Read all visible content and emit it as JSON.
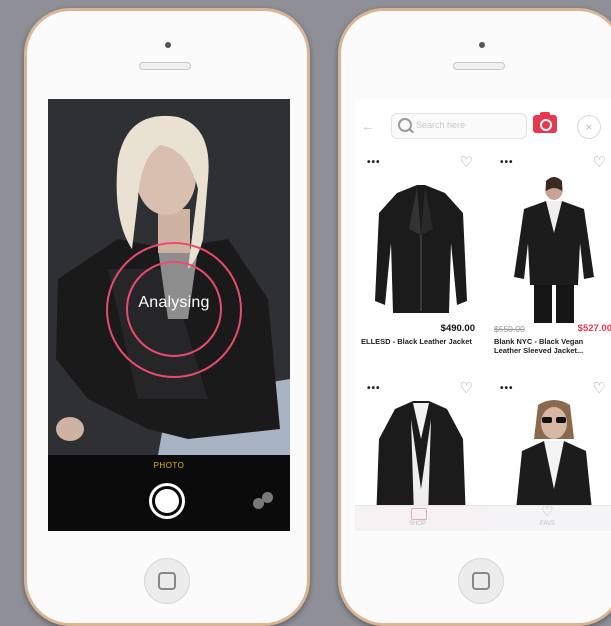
{
  "camera_screen": {
    "status_label": "Analysing",
    "mode_label": "PHOTO"
  },
  "shop_screen": {
    "search": {
      "placeholder": "Search here"
    },
    "products": [
      {
        "name": "ELLESD - Black Leather Jacket",
        "price": "$490.00",
        "old_price": "",
        "sale_price": "",
        "more_label": "•••",
        "image": "black-leather-jacket"
      },
      {
        "name": "Blank NYC - Black Vegan Leather Sleeved Jacket...",
        "price": "",
        "old_price": "$550.00",
        "sale_price": "$527.00",
        "more_label": "•••",
        "image": "model-leather-jacket"
      },
      {
        "name": "",
        "price": "",
        "old_price": "",
        "sale_price": "",
        "more_label": "•••",
        "image": "leather-blazer"
      },
      {
        "name": "",
        "price": "",
        "old_price": "",
        "sale_price": "",
        "more_label": "•••",
        "image": "model-sunglasses-jacket"
      }
    ],
    "tabs": [
      {
        "label": "SHOP",
        "icon": "shop-icon"
      },
      {
        "label": "FAVS",
        "icon": "heart-icon"
      }
    ]
  },
  "colors": {
    "accent": "#e8384f",
    "ring": "#e84c6a",
    "phone_frame": "#d9b596",
    "background": "#8f9097"
  }
}
